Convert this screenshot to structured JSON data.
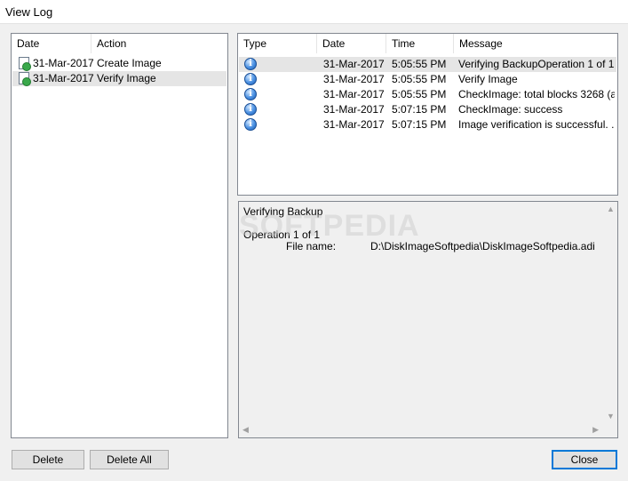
{
  "window": {
    "title": "View Log"
  },
  "sessions": {
    "columns": [
      "Date",
      "Action"
    ],
    "rows": [
      {
        "date": "31-Mar-2017",
        "action": "Create Image",
        "icon": "document-ok-icon"
      },
      {
        "date": "31-Mar-2017",
        "action": "Verify Image",
        "icon": "document-ok-icon"
      }
    ],
    "selected_index": 1
  },
  "messages": {
    "columns": [
      "Type",
      "Date",
      "Time",
      "Message"
    ],
    "rows": [
      {
        "icon": "info-icon",
        "date": "31-Mar-2017",
        "time": "5:05:55 PM",
        "message": "Verifying BackupOperation 1 of 1..."
      },
      {
        "icon": "info-icon",
        "date": "31-Mar-2017",
        "time": "5:05:55 PM",
        "message": "Verify Image"
      },
      {
        "icon": "info-icon",
        "date": "31-Mar-2017",
        "time": "5:05:55 PM",
        "message": "CheckImage: total blocks 3268 (a..."
      },
      {
        "icon": "info-icon",
        "date": "31-Mar-2017",
        "time": "5:07:15 PM",
        "message": "CheckImage: success"
      },
      {
        "icon": "info-icon",
        "date": "31-Mar-2017",
        "time": "5:07:15 PM",
        "message": "Image verification is successful. ..."
      }
    ],
    "selected_index": 0
  },
  "details": {
    "heading": "Verifying Backup",
    "operation": "Operation 1 of 1",
    "file_label": "File name:",
    "file_value": "D:\\DiskImageSoftpedia\\DiskImageSoftpedia.adi",
    "watermark": "SOFTPEDIA"
  },
  "buttons": {
    "delete": "Delete",
    "delete_all": "Delete All",
    "close": "Close"
  }
}
